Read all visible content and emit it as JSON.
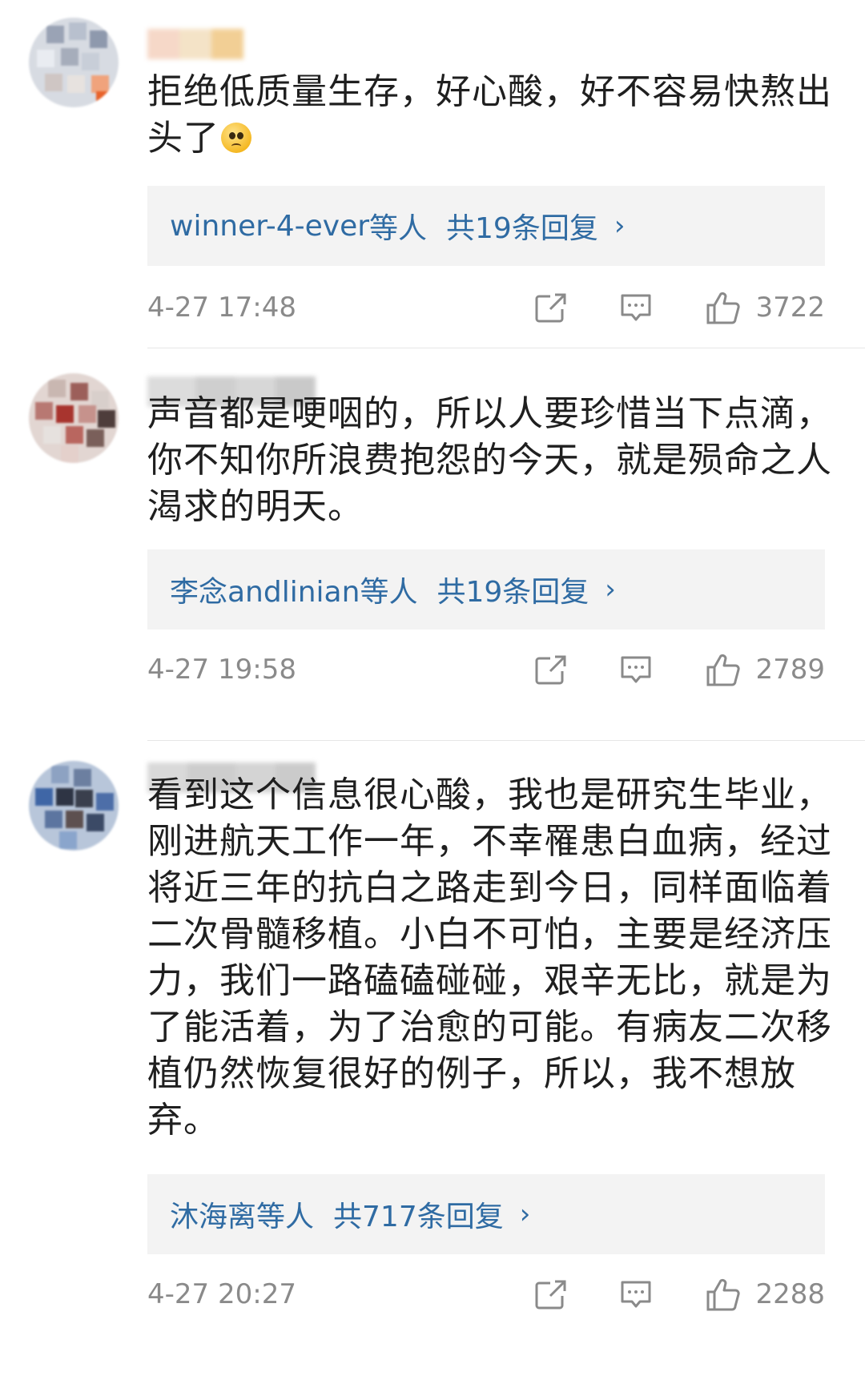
{
  "comments": [
    {
      "content": "拒绝低质量生存，好心酸，好不容易快熬出头了",
      "emoji": "sad-emoji",
      "reply_users": "winner-4-ever",
      "reply_suffix": "等人",
      "reply_count_text": "共19条回复",
      "time": "4-27 17:48",
      "likes": "3722"
    },
    {
      "content": "声音都是哽咽的，所以人要珍惜当下点滴，你不知你所浪费抱怨的今天，就是殒命之人渴求的明天。",
      "reply_users": "李念andlinian",
      "reply_suffix": "等人",
      "reply_count_text": "共19条回复",
      "time": "4-27 19:58",
      "likes": "2789"
    },
    {
      "content": "看到这个信息很心酸，我也是研究生毕业，刚进航天工作一年，不幸罹患白血病，经过将近三年的抗白之路走到今日，同样面临着二次骨髓移植。小白不可怕，主要是经济压力，我们一路磕磕碰碰，艰辛无比，就是为了能活着，为了治愈的可能。有病友二次移植仍然恢复很好的例子，所以，我不想放弃。",
      "reply_users": "沐海离",
      "reply_suffix": "等人",
      "reply_count_text": "共717条回复",
      "time": "4-27 20:27",
      "likes": "2288"
    }
  ],
  "icons": {
    "chevron": "›",
    "share": "share-icon",
    "comment": "comment-icon",
    "like": "thumbs-up-icon"
  },
  "colors": {
    "link": "#2f6ba3",
    "meta": "#8a8a8a",
    "reply_bg": "#f3f3f3"
  }
}
